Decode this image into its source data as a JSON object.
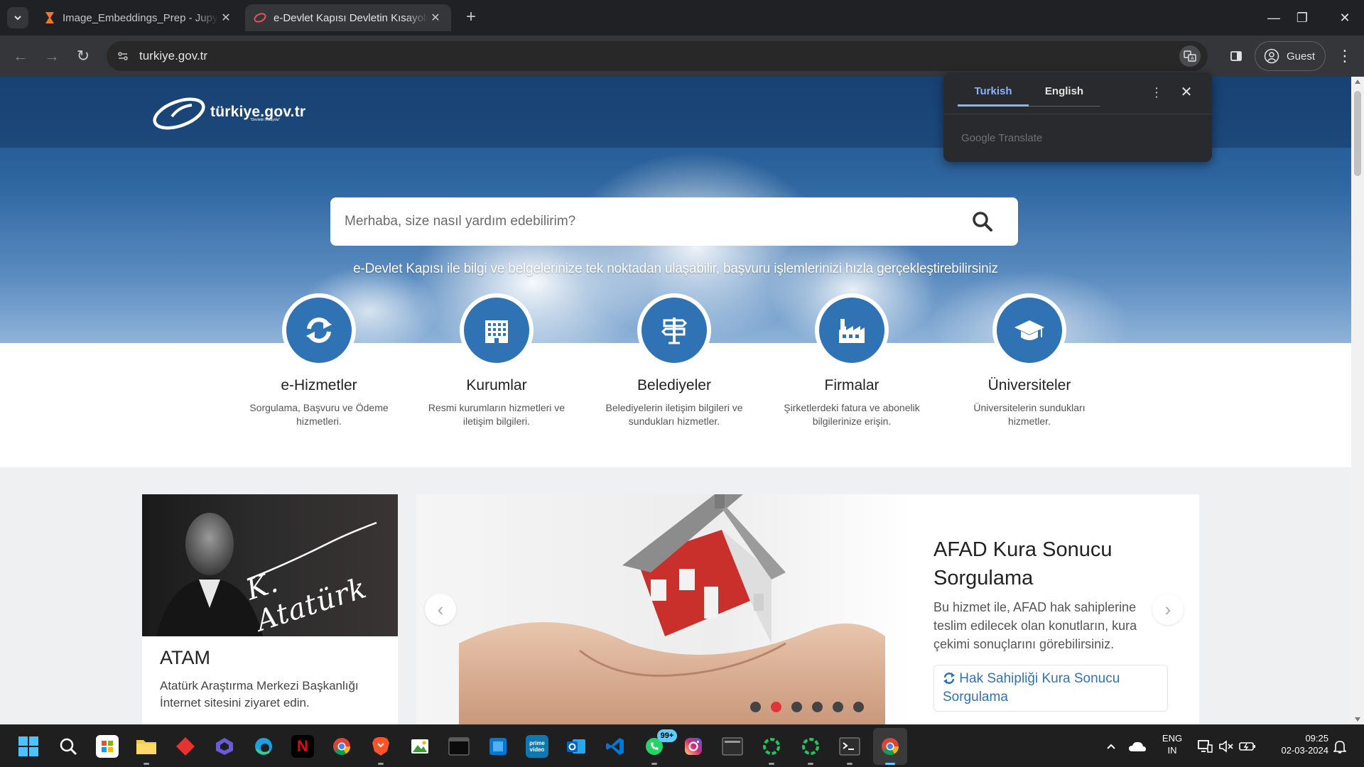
{
  "browser": {
    "tabs": [
      {
        "title": "Image_Embeddings_Prep - Jupyter",
        "active": false
      },
      {
        "title": "e-Devlet Kapısı Devletin Kısayolu",
        "active": true
      }
    ],
    "url": "turkiye.gov.tr",
    "profile_label": "Guest"
  },
  "translate_popup": {
    "source_lang": "Turkish",
    "target_lang": "English",
    "brand": "Google Translate"
  },
  "page": {
    "logo_text": "türkiye.gov.tr",
    "logo_sub": "\"Devletin Kısayolu\"",
    "search_placeholder": "Merhaba, size nasıl yardım edebilirim?",
    "tagline": "e-Devlet Kapısı ile bilgi ve belgelerinize tek noktadan ulaşabilir, başvuru işlemlerinizi hızla gerçekleştirebilirsiniz",
    "categories": [
      {
        "title": "e-Hizmetler",
        "desc": "Sorgulama, Başvuru ve Ödeme hizmetleri.",
        "icon": "refresh-icon"
      },
      {
        "title": "Kurumlar",
        "desc": "Resmi kurumların hizmetleri ve iletişim bilgileri.",
        "icon": "building-icon"
      },
      {
        "title": "Belediyeler",
        "desc": "Belediyelerin iletişim bilgileri ve sundukları hizmetler.",
        "icon": "signpost-icon"
      },
      {
        "title": "Firmalar",
        "desc": "Şirketlerdeki fatura ve abonelik bilgilerinize erişin.",
        "icon": "factory-icon"
      },
      {
        "title": "Üniversiteler",
        "desc": "Üniversitelerin sundukları hizmetler.",
        "icon": "graduation-cap-icon"
      }
    ],
    "atam": {
      "signature": "K. Atatürk",
      "title": "ATAM",
      "desc": "Atatürk Araştırma Merkezi Başkanlığı İnternet sitesini ziyaret edin."
    },
    "slide": {
      "title": "AFAD Kura Sonucu Sorgulama",
      "desc": "Bu hizmet ile, AFAD hak sahiplerine teslim edilecek olan konutların, kura çekimi sonuçlarını görebilirsiniz.",
      "link": "Hak Sahipliği Kura Sonucu Sorgulama",
      "dots": 6,
      "active_dot": 2
    }
  },
  "taskbar": {
    "whatsapp_badge": "99+",
    "lang_line1": "ENG",
    "lang_line2": "IN",
    "time": "09:25",
    "date": "02-03-2024"
  },
  "colors": {
    "accent_blue": "#2f73b4",
    "active_dot": "#e0333a",
    "translate_accent": "#8ab4f8"
  }
}
